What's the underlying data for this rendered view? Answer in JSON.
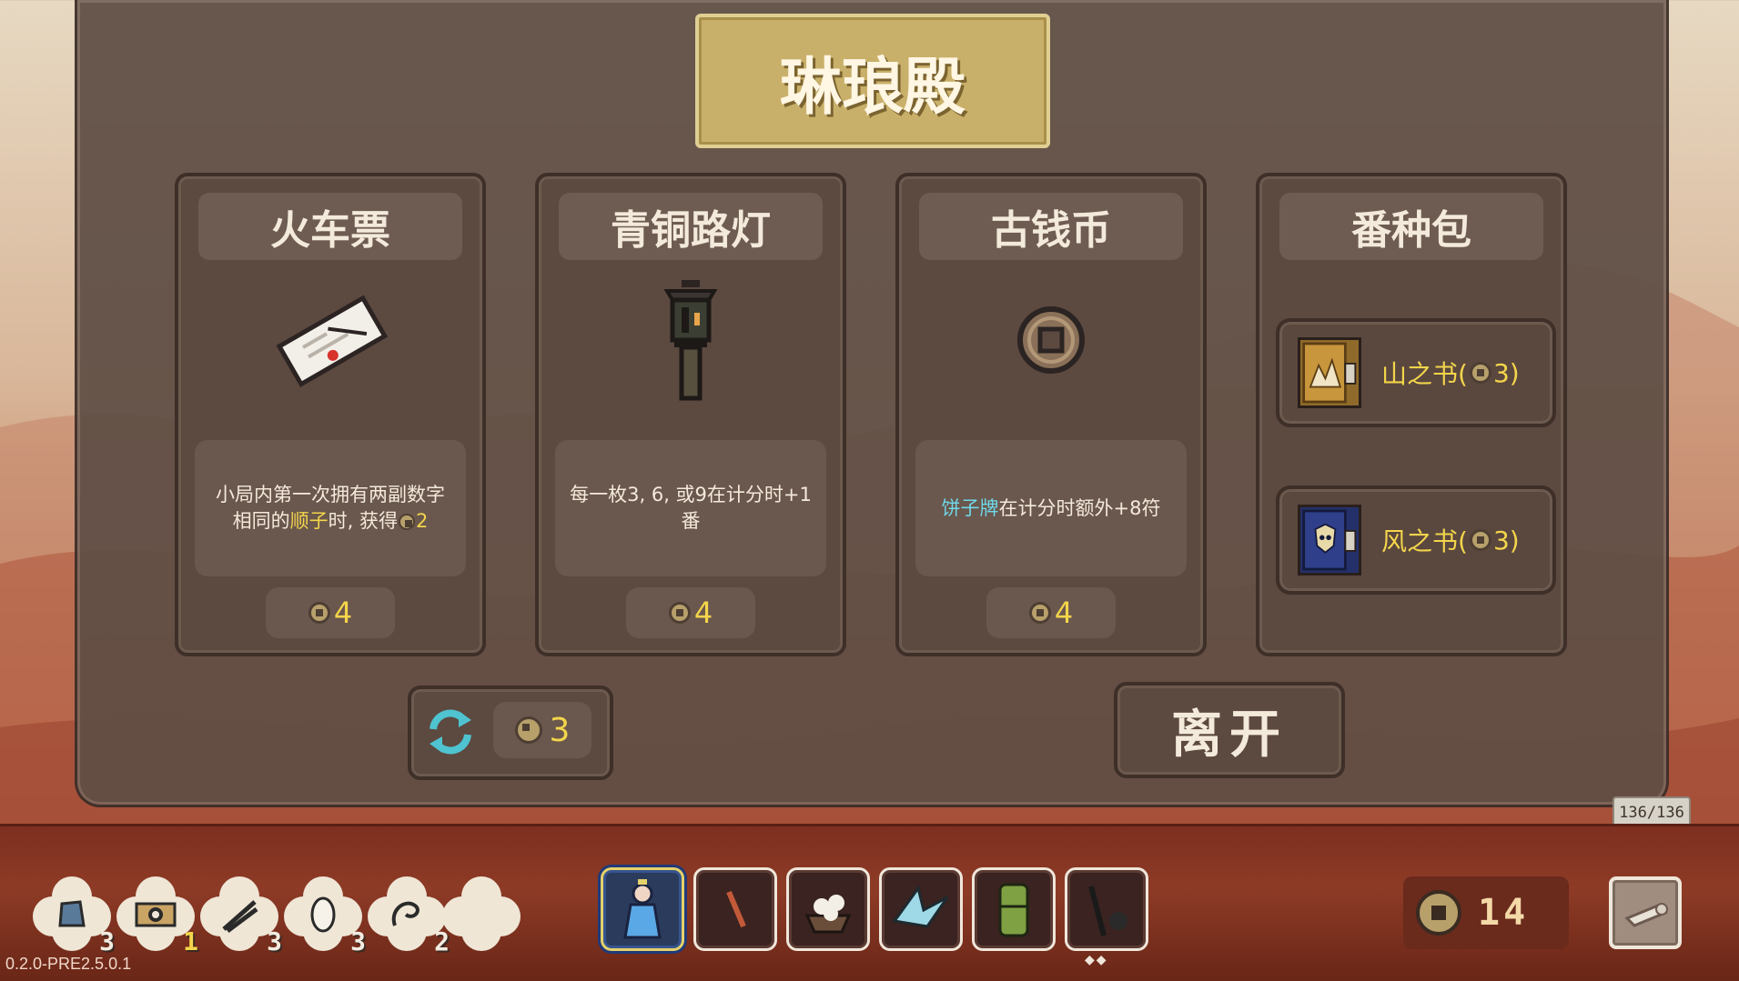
{
  "shop": {
    "title": "琳琅殿",
    "items": [
      {
        "name": "火车票",
        "icon": "train-ticket-icon",
        "desc_parts": [
          "小局内第一次拥有两副数字相同的",
          "顺子",
          "时, 获得",
          "2"
        ],
        "price": "4"
      },
      {
        "name": "青铜路灯",
        "icon": "bronze-streetlamp-icon",
        "desc": "每一枚3, 6, 或9在计分时+1番",
        "price": "4"
      },
      {
        "name": "古钱币",
        "icon": "ancient-coin-icon",
        "desc_parts": [
          "饼子牌",
          "在计分时额外+8符"
        ],
        "price": "4"
      },
      {
        "name": "番种包",
        "books": [
          {
            "label": "山之书(",
            "cost": "3)",
            "icon": "mountain-book-icon"
          },
          {
            "label": "风之书(",
            "cost": "3)",
            "icon": "wind-book-icon"
          }
        ]
      }
    ],
    "reroll_cost": "3",
    "leave_label": "离开"
  },
  "counter": "136/136",
  "inventory": {
    "consumables": [
      {
        "icon": "tile-bag-icon",
        "count": "3"
      },
      {
        "icon": "yin-yang-scroll-icon",
        "count": "1"
      },
      {
        "icon": "tongs-icon",
        "count": "3"
      },
      {
        "icon": "egg-icon",
        "count": "3"
      },
      {
        "icon": "swirl-feather-icon",
        "count": "2"
      },
      {
        "icon": "empty-slot-icon",
        "count": ""
      }
    ],
    "relics": [
      {
        "icon": "blue-goddess-icon",
        "selected": true
      },
      {
        "icon": "red-brush-icon"
      },
      {
        "icon": "dumplings-bowl-icon"
      },
      {
        "icon": "paper-crane-icon"
      },
      {
        "icon": "bamboo-tube-icon"
      },
      {
        "icon": "dragon-staff-icon"
      }
    ]
  },
  "money": "14",
  "version": "0.2.0-PRE2.5.0.1",
  "colors": {
    "price_yellow": "#f3d54b",
    "highlight_cyan": "#6fd8e9",
    "panel_brown": "#5c4940",
    "plaque_gold": "#c9b06a"
  }
}
